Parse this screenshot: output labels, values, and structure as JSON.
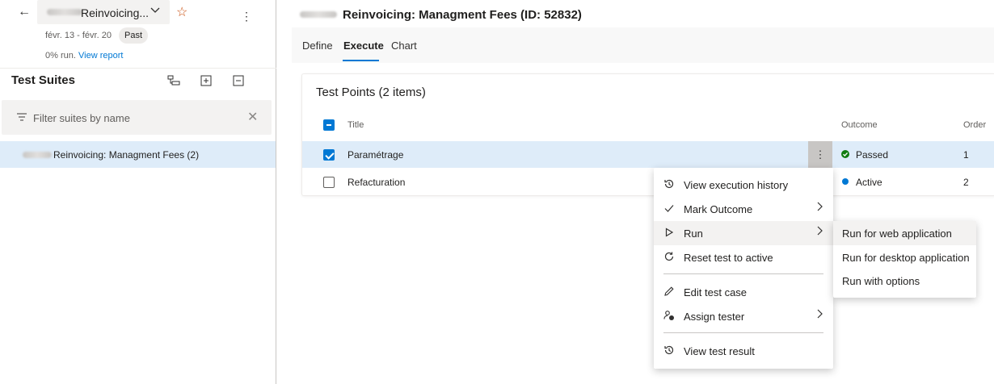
{
  "left": {
    "plan_name": "Reinvoicing...",
    "dates": "févr. 13 - févr. 20",
    "status_badge": "Past",
    "run_stat": "0% run.",
    "view_report": "View report",
    "suites_title": "Test Suites",
    "filter_placeholder": "Filter suites by name",
    "suite_item": "Reinvoicing: Managment Fees (2)"
  },
  "header": {
    "run_title": "Reinvoicing: Managment Fees (ID: 52832)"
  },
  "tabs": [
    {
      "label": "Define"
    },
    {
      "label": "Execute"
    },
    {
      "label": "Chart"
    }
  ],
  "test_points": {
    "title": "Test Points (2 items)",
    "columns": {
      "title": "Title",
      "outcome": "Outcome",
      "order": "Order"
    },
    "rows": [
      {
        "title": "Paramétrage",
        "outcome": "Passed",
        "order": "1",
        "outcome_color": "#107c10",
        "checked": true
      },
      {
        "title": "Refacturation",
        "outcome": "Active",
        "order": "2",
        "outcome_color": "#0078d4",
        "checked": false
      }
    ]
  },
  "menu": {
    "items": [
      {
        "label": "View execution history",
        "icon": "history-icon"
      },
      {
        "label": "Mark Outcome",
        "icon": "checkmark-icon"
      },
      {
        "label": "Run",
        "icon": "play-icon"
      },
      {
        "label": "Reset test to active",
        "icon": "refresh-icon"
      },
      {
        "label": "Edit test case",
        "icon": "edit-icon"
      },
      {
        "label": "Assign tester",
        "icon": "assign-user-icon"
      },
      {
        "label": "View test result",
        "icon": "history-icon"
      }
    ]
  },
  "submenu": {
    "items": [
      {
        "label": "Run for web application"
      },
      {
        "label": "Run for desktop application"
      },
      {
        "label": "Run with options"
      }
    ]
  },
  "colors": {
    "accent": "#0078d4",
    "selection": "#deecf9",
    "passed": "#107c10",
    "star": "#ca5010"
  }
}
